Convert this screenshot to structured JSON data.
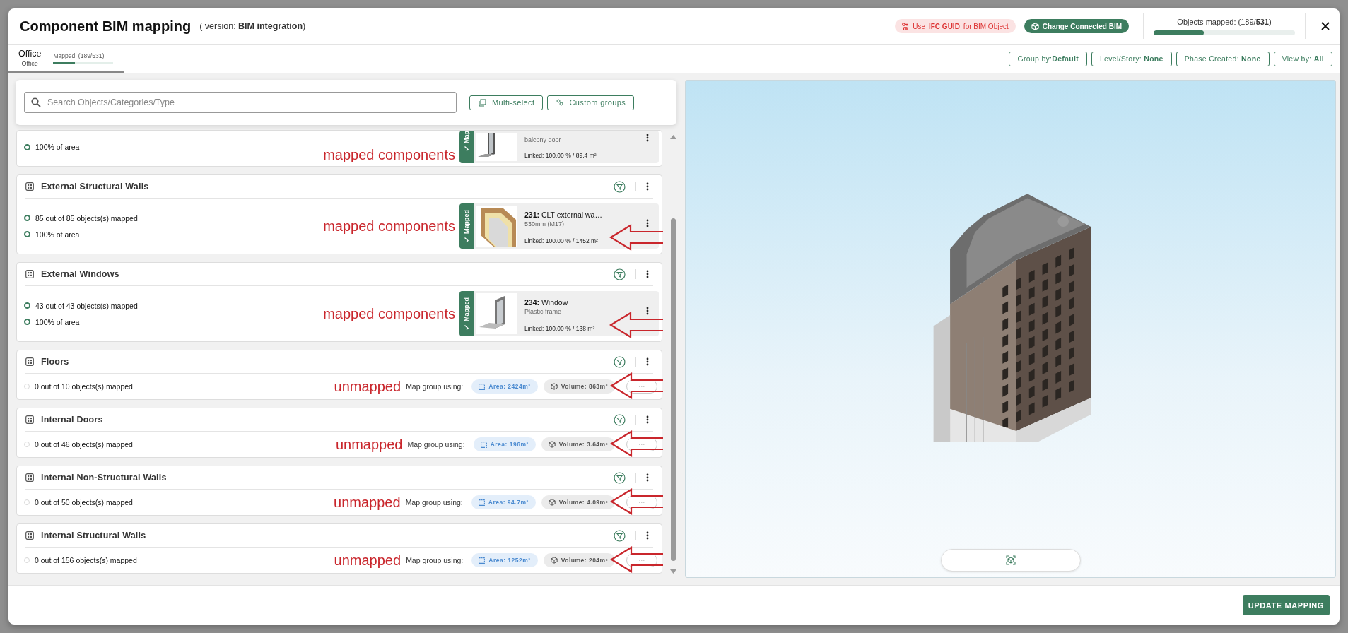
{
  "modal": {
    "title": "Component BIM mapping",
    "version_note": "( version: **BIM integration**)"
  },
  "header_buttons": [
    {
      "kind": "ifc",
      "label": "Use **IFC GUID** for BIM Object"
    },
    {
      "kind": "connected",
      "label": "Change Connected BIM"
    }
  ],
  "objects_mapped": {
    "label": "Objects mapped: (189/**531**)",
    "level": 0.356
  },
  "tabs": [
    {
      "title": "Office",
      "subtitle": "Office",
      "mapped": "Mapped: (189/531)",
      "level": 0.356,
      "selected": true
    }
  ],
  "filters": [
    "Group by:**Default**",
    "Level/Story: **None**",
    "Phase Created: **None**",
    "View by: **All**"
  ],
  "search": {
    "placeholder": "Search Objects/Categories/Type"
  },
  "tools": [
    {
      "kind": "multi",
      "label": "Multi-select"
    },
    {
      "kind": "groups",
      "label": "Custom groups"
    }
  ],
  "groups": [
    {
      "kind": "mapped",
      "stats": [
        {
          "text": "100% of area",
          "done": true
        }
      ],
      "annotation": "mapped components",
      "arrow": false,
      "component": {
        "badge": "Map",
        "kind": "door",
        "description": "balcony door",
        "linked": "Linked: 100.00 % / 89.4 m²"
      }
    },
    {
      "kind": "mapped",
      "title": "External Structural Walls",
      "stats": [
        {
          "text": "85 out of 85 objects(s) mapped",
          "done": true
        },
        {
          "text": "100% of area",
          "done": true
        }
      ],
      "annotation": "mapped components",
      "arrow": true,
      "component": {
        "badge": "Mapped",
        "kind": "wall",
        "name": "**231:** CLT external wa…",
        "description": "530mm (M17)",
        "linked": "Linked: 100.00 % / 1452 m²"
      }
    },
    {
      "kind": "mapped",
      "title": "External Windows",
      "stats": [
        {
          "text": "43 out of 43 objects(s) mapped",
          "done": true
        },
        {
          "text": "100% of area",
          "done": true
        }
      ],
      "annotation": "mapped components",
      "arrow": true,
      "component": {
        "badge": "Mapped",
        "kind": "window",
        "name": "**234:** Window",
        "description": "Plastic frame",
        "linked": "Linked: 100.00 % / 138 m²"
      }
    },
    {
      "kind": "unmapped",
      "title": "Floors",
      "stats": [
        {
          "text": "0 out of 10 objects(s) mapped",
          "done": false
        }
      ],
      "annotation": "unmapped",
      "arrow": true,
      "map_label": "Map group using:",
      "area": "Area: 2424m²",
      "volume": "Volume: 863m²",
      "more": "···"
    },
    {
      "kind": "unmapped",
      "title": "Internal Doors",
      "stats": [
        {
          "text": "0 out of 46 objects(s) mapped",
          "done": false
        }
      ],
      "annotation": "unmapped",
      "arrow": true,
      "map_label": "Map group using:",
      "area": "Area: 196m²",
      "volume": "Volume: 3.64m³",
      "more": "···"
    },
    {
      "kind": "unmapped",
      "title": "Internal Non-Structural Walls",
      "stats": [
        {
          "text": "0 out of 50 objects(s) mapped",
          "done": false
        }
      ],
      "annotation": "unmapped",
      "arrow": true,
      "map_label": "Map group using:",
      "area": "Area: 94.7m²",
      "volume": "Volume: 4.09m³",
      "more": "···"
    },
    {
      "kind": "unmapped",
      "title": "Internal Structural Walls",
      "stats": [
        {
          "text": "0 out of 156 objects(s) mapped",
          "done": false
        }
      ],
      "annotation": "unmapped",
      "arrow": true,
      "map_label": "Map group using:",
      "area": "Area: 1252m²",
      "volume": "Volume: 204m³",
      "more": "···"
    }
  ],
  "footer": {
    "button": "UPDATE MAPPING"
  }
}
